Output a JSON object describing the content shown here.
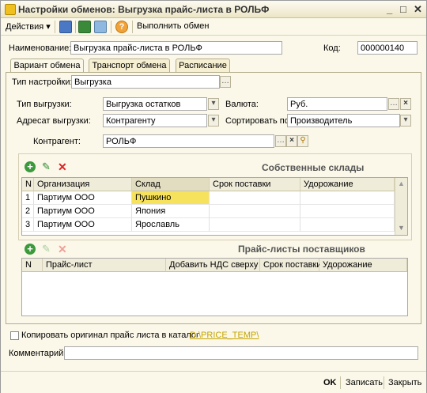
{
  "window": {
    "title": "Настройки обменов: Выгрузка прайс-листа в РОЛЬФ",
    "minimize": "_",
    "maximize": "□",
    "close": "✕"
  },
  "toolbar": {
    "actions_label": "Действия ▾",
    "execute_label": "Выполнить обмен",
    "help_label": "?"
  },
  "header": {
    "name_label": "Наименование:",
    "name_value": "Выгрузка прайс-листа в РОЛЬФ",
    "code_label": "Код:",
    "code_value": "000000140"
  },
  "tabs": [
    {
      "label": "Вариант обмена",
      "active": true
    },
    {
      "label": "Транспорт обмена",
      "active": false
    },
    {
      "label": "Расписание",
      "active": false
    }
  ],
  "settings": {
    "type_label": "Тип настройки:",
    "type_value": "Выгрузка",
    "export_type_label": "Тип выгрузки:",
    "export_type_value": "Выгрузка остатков",
    "currency_label": "Валюта:",
    "currency_value": "Руб.",
    "addressee_label": "Адресат выгрузки:",
    "addressee_value": "Контрагенту",
    "sort_label": "Сортировать по:",
    "sort_value": "Производитель",
    "counterparty_label": "Контрагент:",
    "counterparty_value": "РОЛЬФ"
  },
  "warehouses": {
    "title": "Собственные склады",
    "columns": [
      "N",
      "Организация",
      "Склад",
      "Срок поставки",
      "Удорожание"
    ],
    "rows": [
      {
        "n": "1",
        "org": "Партиум ООО",
        "warehouse": "Пушкино",
        "term": "",
        "markup": ""
      },
      {
        "n": "2",
        "org": "Партиум ООО",
        "warehouse": "Япония",
        "term": "",
        "markup": ""
      },
      {
        "n": "3",
        "org": "Партиум ООО",
        "warehouse": "Ярославль",
        "term": "",
        "markup": ""
      }
    ]
  },
  "pricelists": {
    "title": "Прайс-листы поставщиков",
    "columns": [
      "N",
      "Прайс-лист",
      "Добавить НДС сверху",
      "Срок поставки",
      "Удорожание"
    ]
  },
  "copy": {
    "label": "Копировать оригинал прайс листа в каталог",
    "path": "D:\\PRICE_TEMP\\"
  },
  "comment": {
    "label": "Комментарий:",
    "value": ""
  },
  "footer": {
    "ok_label": "OK",
    "save_label": "Записать",
    "close_label": "Закрыть"
  },
  "colors": {
    "window_bg": "#fbf8e9",
    "selected_cell": "#f7e25e",
    "link": "#c4a500"
  }
}
